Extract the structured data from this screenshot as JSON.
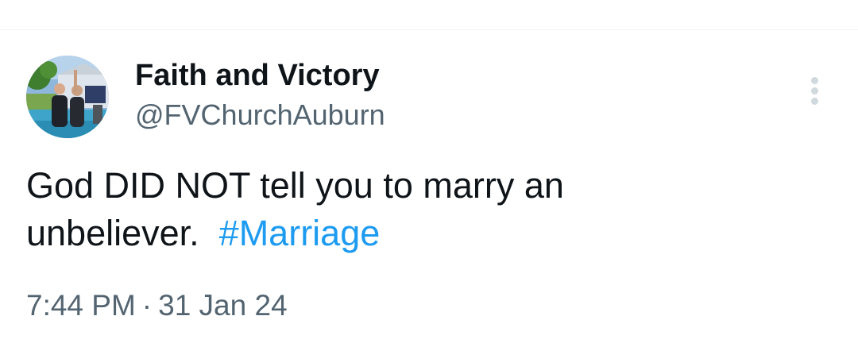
{
  "author": {
    "display_name": "Faith and Victory",
    "handle": "@FVChurchAuburn",
    "avatar_icon": "profile-photo"
  },
  "tweet": {
    "line1": "God DID NOT tell you to marry an",
    "line2_text": "unbeliever.  ",
    "hashtag": "#Marriage"
  },
  "meta": {
    "time": "7:44 PM",
    "separator": "·",
    "date": "31 Jan 24"
  },
  "more_button": {
    "icon": "more-vertical-icon"
  },
  "colors": {
    "text": "#0f1419",
    "secondary": "#536471",
    "link": "#1d9bf0",
    "icon_muted": "#cfd9de"
  }
}
